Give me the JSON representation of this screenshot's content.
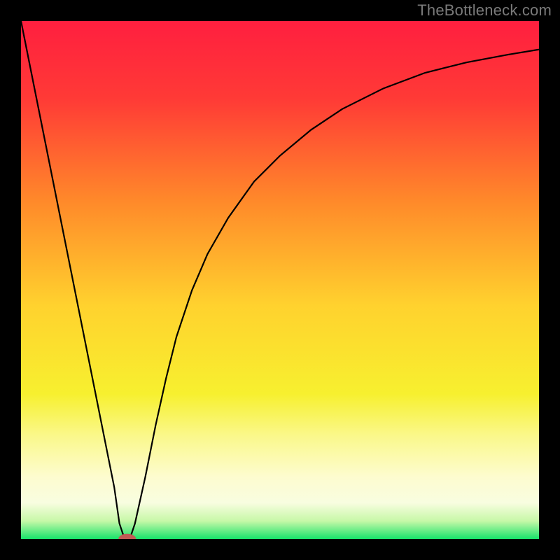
{
  "watermark": "TheBottleneck.com",
  "chart_data": {
    "type": "line",
    "title": "",
    "xlabel": "",
    "ylabel": "",
    "xlim": [
      0,
      100
    ],
    "ylim": [
      0,
      100
    ],
    "grid": false,
    "legend": false,
    "background_gradient": {
      "stops": [
        {
          "offset": 0.0,
          "color": "#ff1f3f"
        },
        {
          "offset": 0.15,
          "color": "#ff3a36"
        },
        {
          "offset": 0.35,
          "color": "#ff8a2a"
        },
        {
          "offset": 0.55,
          "color": "#ffd22e"
        },
        {
          "offset": 0.72,
          "color": "#f7f02f"
        },
        {
          "offset": 0.8,
          "color": "#faf88a"
        },
        {
          "offset": 0.88,
          "color": "#fdfccf"
        },
        {
          "offset": 0.93,
          "color": "#f8fde0"
        },
        {
          "offset": 0.965,
          "color": "#c7f8a8"
        },
        {
          "offset": 1.0,
          "color": "#17e36a"
        }
      ]
    },
    "series": [
      {
        "name": "bottleneck-curve",
        "color": "#000000",
        "width": 2.2,
        "x": [
          0,
          2,
          4,
          6,
          8,
          10,
          12,
          14,
          16,
          18,
          19,
          20,
          21,
          22,
          24,
          26,
          28,
          30,
          33,
          36,
          40,
          45,
          50,
          56,
          62,
          70,
          78,
          86,
          94,
          100
        ],
        "y": [
          100,
          90,
          80,
          70,
          60,
          50,
          40,
          30,
          20,
          10,
          3,
          0,
          0,
          3,
          12,
          22,
          31,
          39,
          48,
          55,
          62,
          69,
          74,
          79,
          83,
          87,
          90,
          92,
          93.5,
          94.5
        ]
      }
    ],
    "marker": {
      "name": "optimal-point",
      "x": 20.5,
      "y": 0,
      "rx": 1.7,
      "ry": 1.0,
      "fill": "#c15b55"
    }
  }
}
